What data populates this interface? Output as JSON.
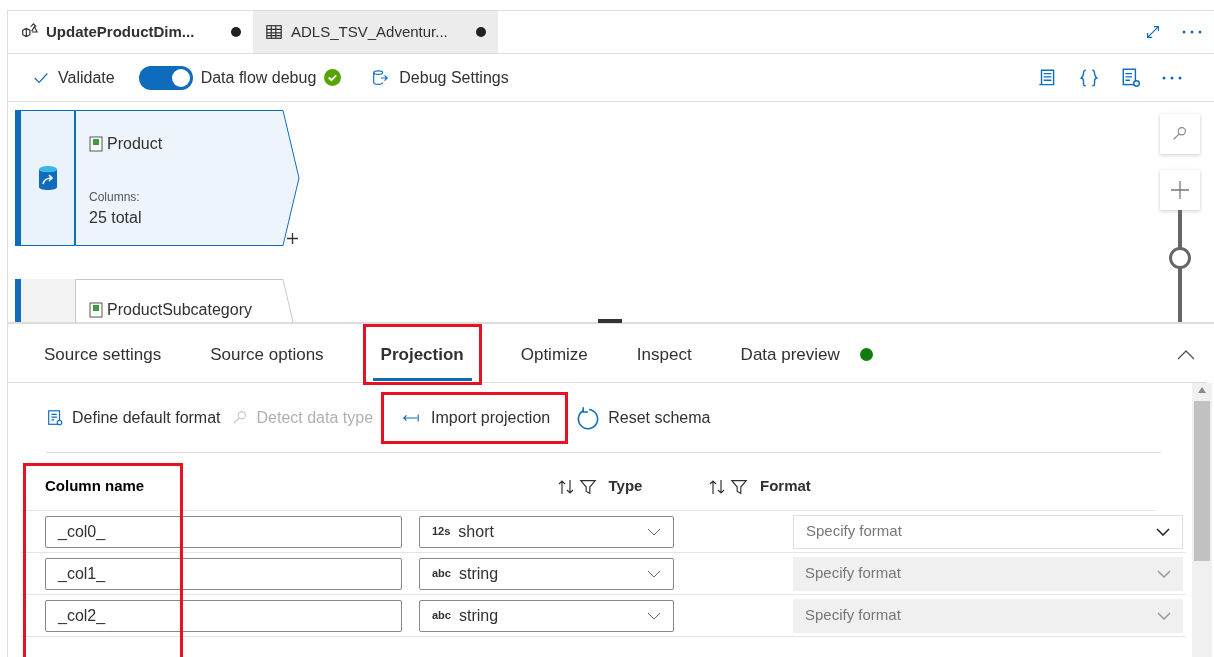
{
  "editor_tabs": [
    {
      "label": "UpdateProductDim...",
      "kind": "dataflow",
      "selected": true,
      "unsaved": true
    },
    {
      "label": "ADLS_TSV_Adventur...",
      "kind": "dataset",
      "selected": false,
      "unsaved": true
    }
  ],
  "toolbar": {
    "validate": "Validate",
    "debug_label": "Data flow debug",
    "debug_on": true,
    "debug_ready": true,
    "debug_settings": "Debug Settings"
  },
  "canvas": {
    "nodes": [
      {
        "title": "Product",
        "columns_label": "Columns:",
        "columns_value": "25 total",
        "selected": true
      },
      {
        "title": "ProductSubcategory",
        "selected": false
      }
    ],
    "zoom": {
      "level": 0.62
    }
  },
  "panel_tabs": [
    {
      "label": "Source settings",
      "selected": false,
      "highlighted": false
    },
    {
      "label": "Source options",
      "selected": false,
      "highlighted": false
    },
    {
      "label": "Projection",
      "selected": true,
      "highlighted": true
    },
    {
      "label": "Optimize",
      "selected": false,
      "highlighted": false
    },
    {
      "label": "Inspect",
      "selected": false,
      "highlighted": false
    },
    {
      "label": "Data preview",
      "selected": false,
      "highlighted": false,
      "color": "#107c10"
    }
  ],
  "actions": [
    {
      "label": "Define default format",
      "kind": "format",
      "disabled": false,
      "highlighted": false
    },
    {
      "label": "Detect data type",
      "kind": "detect",
      "disabled": true,
      "highlighted": false
    },
    {
      "label": "Import projection",
      "kind": "import",
      "disabled": false,
      "highlighted": true
    },
    {
      "label": "Reset schema",
      "kind": "reset",
      "disabled": false,
      "highlighted": false
    }
  ],
  "table": {
    "columns": [
      {
        "label": "Column name",
        "highlighted": true
      },
      {
        "label": "Type",
        "highlighted": false
      },
      {
        "label": "Format",
        "highlighted": false
      }
    ],
    "rows": [
      {
        "name": "_col0_",
        "type_badge": "12s",
        "type": "short",
        "format_placeholder": "Specify format",
        "format_disabled": false
      },
      {
        "name": "_col1_",
        "type_badge": "abc",
        "type": "string",
        "format_placeholder": "Specify format",
        "format_disabled": true
      },
      {
        "name": "_col2_",
        "type_badge": "abc",
        "type": "string",
        "format_placeholder": "Specify format",
        "format_disabled": true
      }
    ]
  }
}
